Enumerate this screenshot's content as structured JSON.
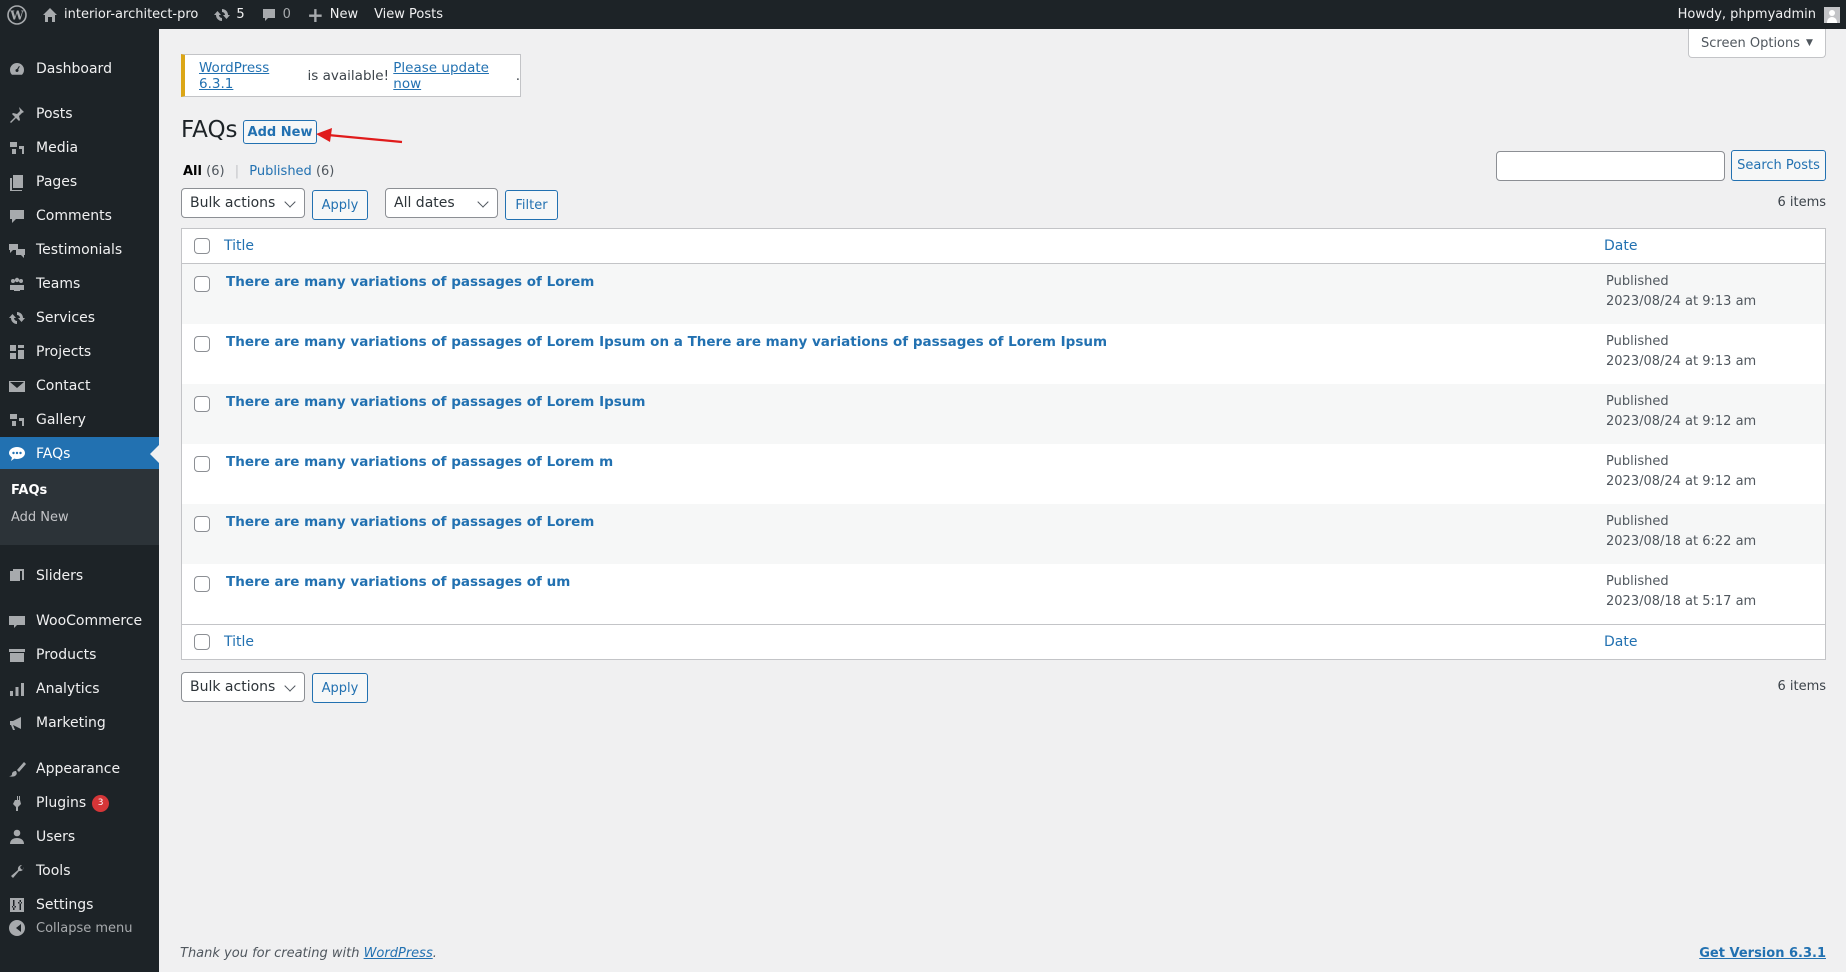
{
  "adminbar": {
    "site_name": "interior-architect-pro",
    "updates_count": "5",
    "comments_count": "0",
    "new_label": "New",
    "view_posts_label": "View Posts",
    "howdy": "Howdy, phpmyadmin"
  },
  "sidebar": {
    "items": [
      {
        "label": "Dashboard",
        "icon": "dashboard-icon"
      },
      {
        "label": "Posts",
        "icon": "pin-icon"
      },
      {
        "label": "Media",
        "icon": "media-icon"
      },
      {
        "label": "Pages",
        "icon": "pages-icon"
      },
      {
        "label": "Comments",
        "icon": "comment-icon"
      },
      {
        "label": "Testimonials",
        "icon": "testimonials-icon"
      },
      {
        "label": "Teams",
        "icon": "groups-icon"
      },
      {
        "label": "Services",
        "icon": "update-icon"
      },
      {
        "label": "Projects",
        "icon": "portfolio-icon"
      },
      {
        "label": "Contact",
        "icon": "email-icon"
      },
      {
        "label": "Gallery",
        "icon": "gallery-icon"
      },
      {
        "label": "FAQs",
        "icon": "faq-bubble-icon"
      },
      {
        "label": "Sliders",
        "icon": "slides-icon"
      },
      {
        "label": "WooCommerce",
        "icon": "woo-icon"
      },
      {
        "label": "Products",
        "icon": "archive-icon"
      },
      {
        "label": "Analytics",
        "icon": "chart-bar-icon"
      },
      {
        "label": "Marketing",
        "icon": "megaphone-icon"
      },
      {
        "label": "Appearance",
        "icon": "brush-icon"
      },
      {
        "label": "Plugins",
        "icon": "plugin-icon",
        "badge": "3"
      },
      {
        "label": "Users",
        "icon": "user-icon"
      },
      {
        "label": "Tools",
        "icon": "wrench-icon"
      },
      {
        "label": "Settings",
        "icon": "settings-icon"
      }
    ],
    "submenu": [
      "FAQs",
      "Add New"
    ],
    "collapse_label": "Collapse menu"
  },
  "screen_options_label": "Screen Options",
  "notice": {
    "version_link": "WordPress 6.3.1",
    "middle_text": " is available! ",
    "update_link": "Please update now",
    "end": "."
  },
  "page": {
    "title": "FAQs",
    "add_new_label": "Add New"
  },
  "views": {
    "all_label": "All",
    "all_count": "(6)",
    "separator": "|",
    "published_label": "Published",
    "published_count": "(6)"
  },
  "filters": {
    "bulk_actions": "Bulk actions",
    "apply_label": "Apply",
    "dates": "All dates",
    "filter_label": "Filter",
    "search_value": "",
    "search_button": "Search Posts",
    "items_count": "6 items"
  },
  "table": {
    "columns": {
      "title": "Title",
      "date": "Date"
    },
    "rows": [
      {
        "title": "There are many variations of passages of Lorem",
        "status": "Published",
        "date": "2023/08/24 at 9:13 am"
      },
      {
        "title": "There are many variations of passages of Lorem Ipsum on a There are many variations of passages of Lorem Ipsum",
        "status": "Published",
        "date": "2023/08/24 at 9:13 am"
      },
      {
        "title": "There are many variations of passages of Lorem Ipsum",
        "status": "Published",
        "date": "2023/08/24 at 9:12 am"
      },
      {
        "title": "There are many variations of passages of Lorem m",
        "status": "Published",
        "date": "2023/08/24 at 9:12 am"
      },
      {
        "title": "There are many variations of passages of Lorem",
        "status": "Published",
        "date": "2023/08/18 at 6:22 am"
      },
      {
        "title": "There are many variations of passages of um",
        "status": "Published",
        "date": "2023/08/18 at 5:17 am"
      }
    ]
  },
  "footer": {
    "thanks_text": "Thank you for creating with ",
    "wp_link": "WordPress",
    "period": ".",
    "version_link": "Get Version 6.3.1"
  },
  "colors": {
    "admin_dark": "#1d2327",
    "accent": "#2271b1",
    "notice_warning": "#dba617",
    "annotation_arrow": "#e01b1b"
  }
}
